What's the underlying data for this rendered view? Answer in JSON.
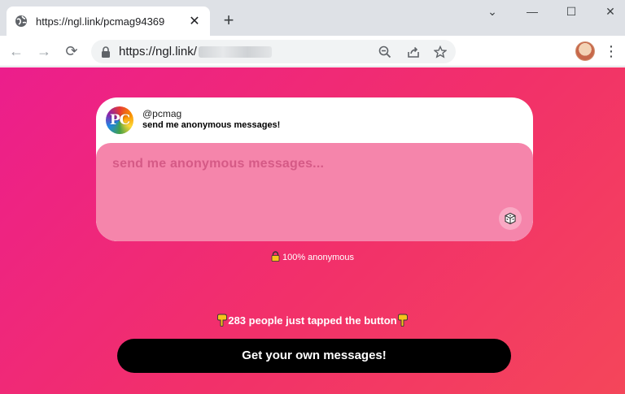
{
  "browser": {
    "tab_title": "https://ngl.link/pcmag94369",
    "tab_close": "✕",
    "new_tab": "+",
    "win_minimize": "—",
    "win_maximize": "☐",
    "win_close": "✕",
    "win_chevron": "⌄",
    "nav_back": "←",
    "nav_forward": "→",
    "nav_reload": "⟳",
    "url_text": "https://ngl.link/",
    "menu": "⋮"
  },
  "page": {
    "handle": "@pcmag",
    "prompt": "send me anonymous messages!",
    "logo_text": "PC",
    "message_placeholder": "send me anonymous messages...",
    "anonymous_note": "100% anonymous",
    "tapped_text": "283 people just tapped the button",
    "cta_label": "Get your own messages!"
  },
  "colors": {
    "page_gradient_start": "#ec1e8c",
    "page_gradient_end": "#f4465a",
    "message_box": "#f585ab",
    "placeholder": "#d55a86",
    "cta": "#000000"
  },
  "icons": [
    "globe-icon",
    "lock-icon",
    "zoom-out-icon",
    "share-icon",
    "star-icon",
    "dice-icon",
    "padlock-icon",
    "pointing-down-hand-icon"
  ]
}
